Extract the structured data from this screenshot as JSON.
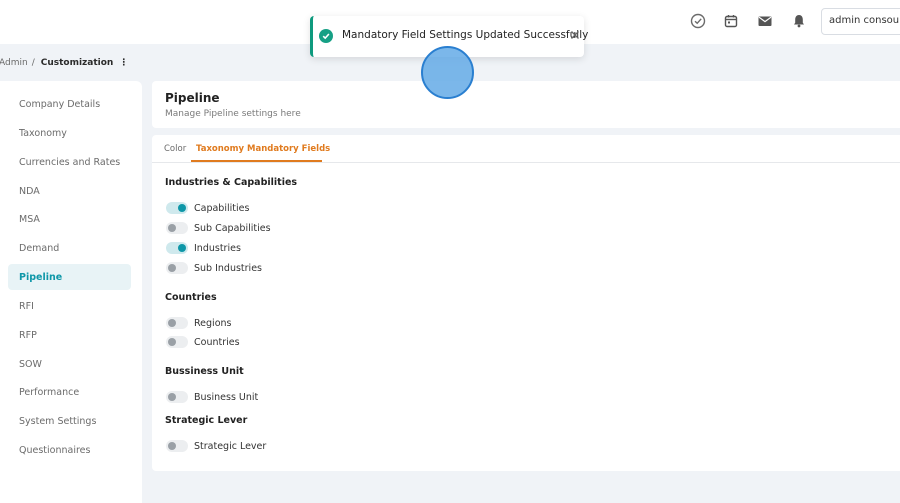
{
  "topbar": {
    "icons": [
      "check-circle-icon",
      "calendar-icon",
      "mail-icon",
      "bell-icon"
    ],
    "user_label": "admin consourc"
  },
  "breadcrumb": {
    "parent": "Admin",
    "separator": "/",
    "current": "Customization",
    "menu_glyph": "⋮"
  },
  "sidebar": {
    "items": [
      {
        "label": "Company Details"
      },
      {
        "label": "Taxonomy"
      },
      {
        "label": "Currencies and Rates"
      },
      {
        "label": "NDA"
      },
      {
        "label": "MSA"
      },
      {
        "label": "Demand"
      },
      {
        "label": "Pipeline",
        "active": true
      },
      {
        "label": "RFI"
      },
      {
        "label": "RFP"
      },
      {
        "label": "SOW"
      },
      {
        "label": "Performance"
      },
      {
        "label": "System Settings"
      },
      {
        "label": "Questionnaires"
      }
    ]
  },
  "header": {
    "title": "Pipeline",
    "subtitle": "Manage Pipeline settings here"
  },
  "tabs": [
    {
      "label": "Color",
      "active": false
    },
    {
      "label": "Taxonomy Mandatory Fields",
      "active": true
    }
  ],
  "sections": [
    {
      "title": "Industries & Capabilities",
      "toggles": [
        {
          "label": "Capabilities",
          "on": true
        },
        {
          "label": "Sub Capabilities",
          "on": false
        },
        {
          "label": "Industries",
          "on": true
        },
        {
          "label": "Sub Industries",
          "on": false
        }
      ]
    },
    {
      "title": "Countries",
      "toggles": [
        {
          "label": "Regions",
          "on": false
        },
        {
          "label": "Countries",
          "on": false
        }
      ]
    },
    {
      "title": "Bussiness Unit",
      "toggles": [
        {
          "label": "Business Unit",
          "on": false
        }
      ]
    },
    {
      "title": "Strategic Lever",
      "toggles": [
        {
          "label": "Strategic Lever",
          "on": false
        }
      ]
    }
  ],
  "toast": {
    "message": "Mandatory Field Settings Updated Successfully",
    "icon": "check-circle-icon",
    "close_icon": "close-icon"
  },
  "colors": {
    "accent": "#0e97a8",
    "tab_active": "#e07b1f",
    "success": "#16a085"
  }
}
